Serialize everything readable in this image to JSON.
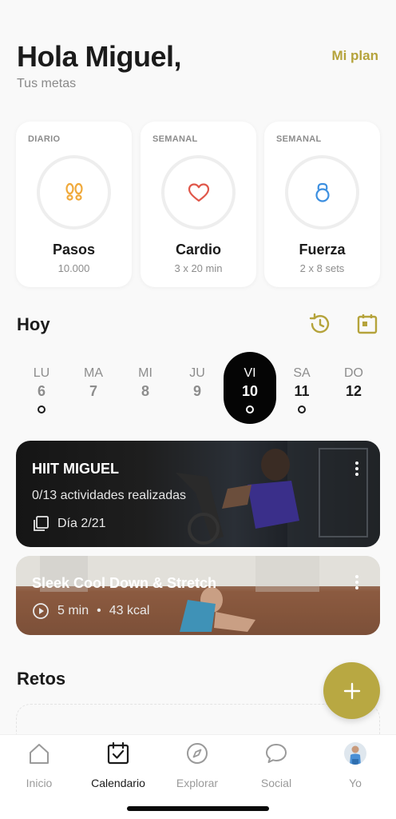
{
  "header": {
    "greeting": "Hola Miguel,",
    "subtitle": "Tus metas",
    "plan_link": "Mi plan"
  },
  "goals": [
    {
      "period": "DIARIO",
      "title": "Pasos",
      "value": "10.000",
      "icon": "footprints-icon",
      "color": "#f0a93a"
    },
    {
      "period": "SEMANAL",
      "title": "Cardio",
      "value": "3 x 20 min",
      "icon": "heart-icon",
      "color": "#e0574a"
    },
    {
      "period": "SEMANAL",
      "title": "Fuerza",
      "value": "2 x 8 sets",
      "icon": "kettlebell-icon",
      "color": "#3c8fe0"
    }
  ],
  "today": {
    "title": "Hoy",
    "days": [
      {
        "name": "LU",
        "num": "6",
        "dot": true
      },
      {
        "name": "MA",
        "num": "7",
        "dot": false
      },
      {
        "name": "MI",
        "num": "8",
        "dot": false
      },
      {
        "name": "JU",
        "num": "9",
        "dot": false
      },
      {
        "name": "VI",
        "num": "10",
        "dot": true,
        "selected": true
      },
      {
        "name": "SA",
        "num": "11",
        "dot": true
      },
      {
        "name": "DO",
        "num": "12",
        "dot": false
      }
    ]
  },
  "workouts": [
    {
      "title": "HIIT MIGUEL",
      "subtitle": "0/13 actividades realizadas",
      "meta": "Día 2/21"
    },
    {
      "title": "Sleek Cool Down & Stretch",
      "duration": "5 min",
      "separator": "•",
      "kcal": "43 kcal"
    }
  ],
  "challenges": {
    "title": "Retos"
  },
  "tabs": [
    {
      "label": "Inicio",
      "icon": "home-icon"
    },
    {
      "label": "Calendario",
      "icon": "calendar-check-icon",
      "active": true
    },
    {
      "label": "Explorar",
      "icon": "compass-icon"
    },
    {
      "label": "Social",
      "icon": "chat-bubble-icon"
    },
    {
      "label": "Yo",
      "icon": "avatar"
    }
  ],
  "colors": {
    "accent": "#b8a842",
    "plan_link": "#b5a33b"
  }
}
